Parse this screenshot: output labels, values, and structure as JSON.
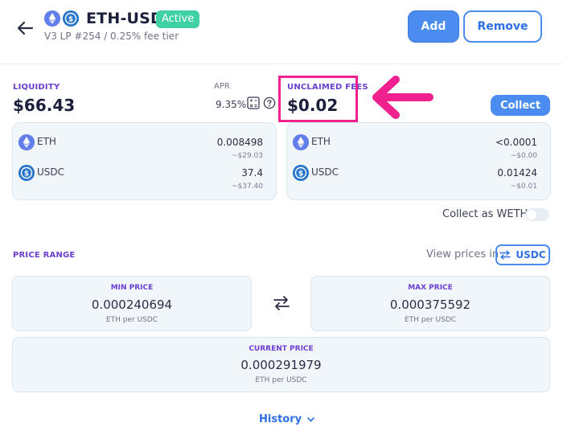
{
  "header": {
    "title": "ETH-USDC",
    "status": "Active",
    "subtitle": "V3 LP #254 / 0.25% fee tier",
    "add_label": "Add",
    "remove_label": "Remove"
  },
  "liquidity": {
    "label": "LIQUIDITY",
    "value": "$66.43",
    "tokens": [
      {
        "name": "ETH",
        "amount": "0.008498",
        "usd": "~$29.03"
      },
      {
        "name": "USDC",
        "amount": "37.4",
        "usd": "~$37.40"
      }
    ]
  },
  "apr": {
    "label": "APR",
    "value": "9.35%"
  },
  "fees": {
    "label": "UNCLAIMED FEES",
    "value": "$0.02",
    "collect_label": "Collect",
    "tokens": [
      {
        "name": "ETH",
        "amount": "<0.0001",
        "usd": "~$0.00"
      },
      {
        "name": "USDC",
        "amount": "0.01424",
        "usd": "~$0.01"
      }
    ],
    "weth_label": "Collect as WETH"
  },
  "price_range": {
    "label": "PRICE RANGE",
    "view_prices_label": "View prices in",
    "view_prices_token": "USDC",
    "min": {
      "label": "MIN PRICE",
      "value": "0.000240694",
      "unit": "ETH per USDC"
    },
    "max": {
      "label": "MAX PRICE",
      "value": "0.000375592",
      "unit": "ETH per USDC"
    },
    "current": {
      "label": "CURRENT PRICE",
      "value": "0.000291979",
      "unit": "ETH per USDC"
    }
  },
  "history_label": "History",
  "colors": {
    "accent": "#4a8cf0",
    "highlight": "#f0218f",
    "active_badge": "#3fd0a4",
    "section_label": "#6b3fd0"
  }
}
